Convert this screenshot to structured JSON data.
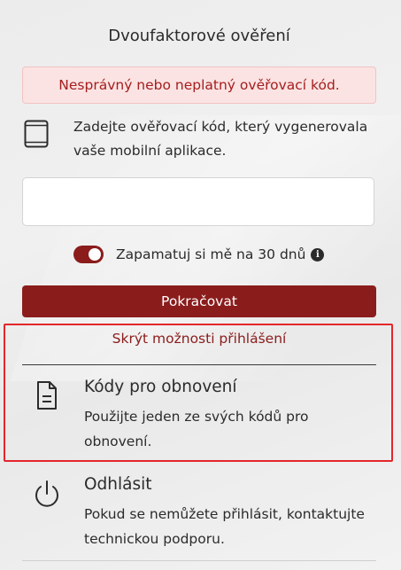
{
  "page": {
    "title": "Dvoufaktorové ověření"
  },
  "alert": {
    "text": "Nesprávný nebo neplatný ověřovací kód."
  },
  "instructions": {
    "text": "Zadejte ověřovací kód, který vygenerovala vaše mobilní aplikace."
  },
  "code_input": {
    "value": "",
    "placeholder": ""
  },
  "remember": {
    "label": "Zapamatuj si mě na 30 dnů",
    "checked": true,
    "info_icon": "info-icon"
  },
  "continue_button": {
    "label": "Pokračovat"
  },
  "options_toggle": {
    "label": "Skrýt možnosti přihlášení"
  },
  "options": [
    {
      "title": "Kódy pro obnovení",
      "description": "Použijte jeden ze svých kódů pro obnovení.",
      "icon": "document-icon"
    },
    {
      "title": "Odhlásit",
      "description": "Pokud se nemůžete přihlásit, kontaktujte technickou podporu.",
      "icon": "power-icon"
    }
  ],
  "colors": {
    "accent": "#8b1c1c",
    "alert_background": "#fbe3e3",
    "alert_text": "#a51d1d",
    "highlight_border": "#e4262c"
  }
}
